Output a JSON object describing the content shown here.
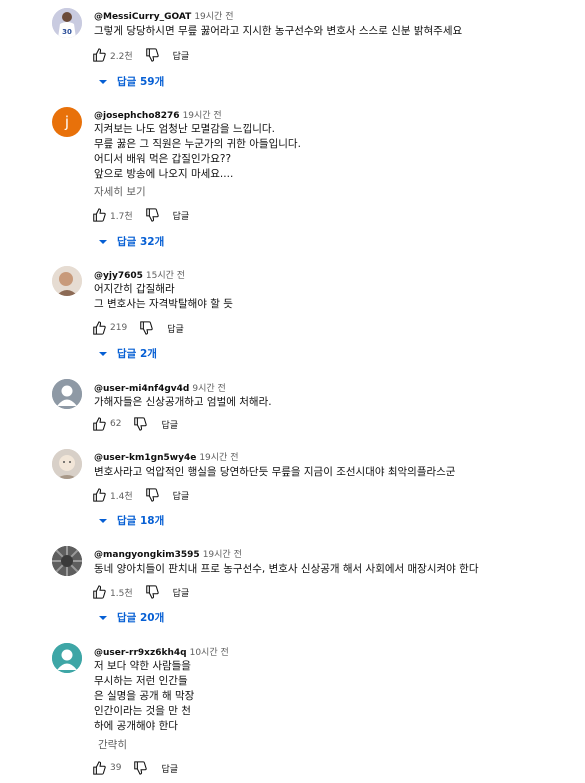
{
  "reply_label": "답글",
  "more_label": "자세히 보기",
  "comments": [
    {
      "author": "@MessiCurry_GOAT",
      "time": "19시간 전",
      "lines": [
        "그렇게 당당하시면 무릎 꿇어라고 지시한 농구선수와 변호사 스스로 신분 밝혀주세요"
      ],
      "likes": "2.2천",
      "replies": "답글 59개",
      "avatar": {
        "type": "photo",
        "badge": "30",
        "colors": [
          "#c9cbe0",
          "#ffffff",
          "#2c4f9a"
        ]
      }
    },
    {
      "author": "@josephcho8276",
      "time": "19시간 전",
      "lines": [
        "지켜보는 나도 엄청난 모멸감을 느낍니다.",
        "무릎 꿇은 그 직원은 누군가의 귀한 아들입니다.",
        "어디서 배워 먹은 갑질인가요??",
        "앞으로 방송에 나오지 마세요...."
      ],
      "more": true,
      "likes": "1.7천",
      "replies": "답글 32개",
      "avatar": {
        "type": "letter",
        "letter": "j",
        "color": "#e8710a"
      }
    },
    {
      "author": "@yjy7605",
      "time": "15시간 전",
      "lines": [
        "어지간히 갑질해라",
        "그 변호사는 자격박탈해야 할 듯"
      ],
      "likes": "219",
      "replies": "답글 2개",
      "avatar": {
        "type": "photo",
        "colors": [
          "#e6dcd2",
          "#c89a7a",
          "#8c6a55"
        ]
      }
    },
    {
      "author": "@user-mi4nf4gv4d",
      "time": "9시간 전",
      "lines": [
        "가해자들은 신상공개하고 엄벌에 처해라."
      ],
      "likes": "62",
      "avatar": {
        "type": "default",
        "color": "#8e99a5"
      }
    },
    {
      "author": "@user-km1gn5wy4e",
      "time": "19시간 전",
      "lines": [
        "변호사라고 억압적인 행실을 당연하단듯 무릎을 지금이 조선시대야 최악의플라스군"
      ],
      "likes": "1.4천",
      "replies": "답글 18개",
      "avatar": {
        "type": "photo",
        "colors": [
          "#d8d0c8",
          "#f2e6d8",
          "#a89888"
        ]
      }
    },
    {
      "author": "@mangyongkim3595",
      "time": "19시간 전",
      "lines": [
        "동네 양아치들이 판치내 프로 농구선수, 변호사 신상공개 해서 사회에서 매장시켜야 한다"
      ],
      "likes": "1.5천",
      "replies": "답글 20개",
      "avatar": {
        "type": "photo",
        "colors": [
          "#3a3a3a",
          "#9a9a9a",
          "#5e5e5e"
        ]
      }
    },
    {
      "author": "@user-rr9xz6kh4q",
      "time": "10시간 전",
      "lines": [
        "저 보다 약한 사람들을",
        "무시하는 저런 인간들",
        "은 실명을 공개 해 막장",
        "인간이라는 것을 만 천",
        "하에 공개해야 한다"
      ],
      "short_label": "간략히",
      "likes": "39",
      "avatar": {
        "type": "default",
        "color": "#3ea6a6"
      }
    }
  ]
}
